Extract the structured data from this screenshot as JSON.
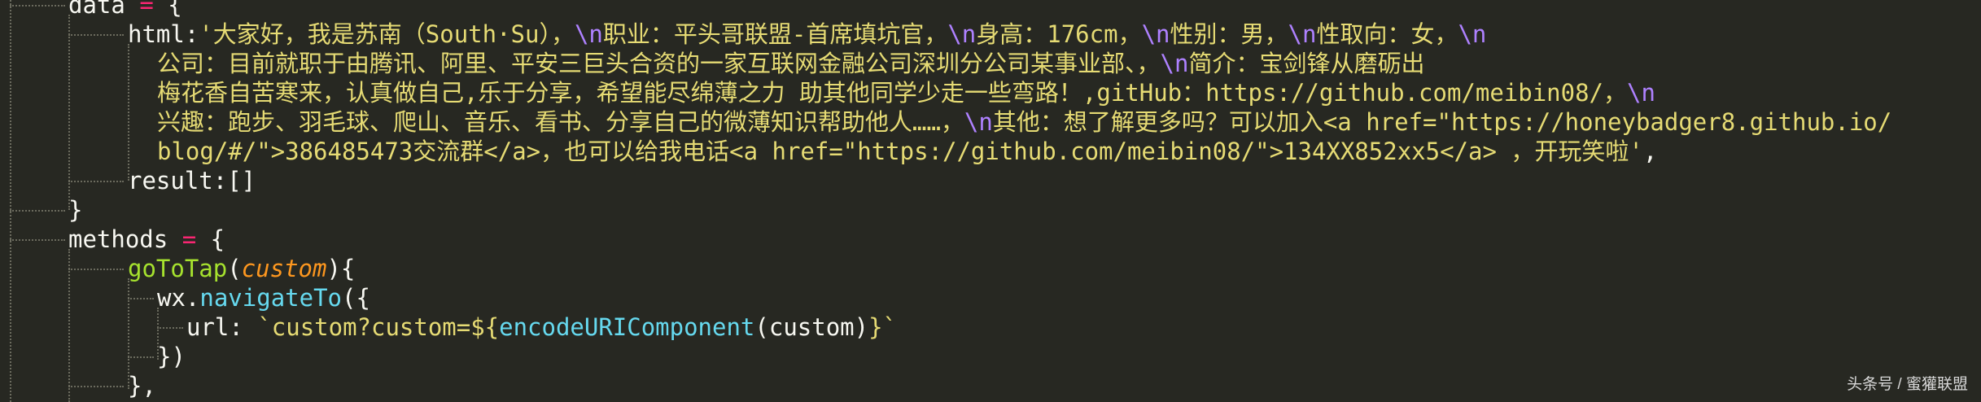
{
  "code": {
    "line1": {
      "ident": "data",
      "op": "=",
      "brace": "{"
    },
    "line2": {
      "key": "html:",
      "s1": "'大家好，我是苏南（South·Su），",
      "e1": "\\n",
      "s2": "职业：平头哥联盟-首席填坑官，",
      "e2": "\\n",
      "s3": "身高：176cm，",
      "e3": "\\n",
      "s4": "性别：男，",
      "e4": "\\n",
      "s5": "性取向：女，",
      "e5": "\\n"
    },
    "line3": {
      "s1": "公司：目前就职于由腾讯、阿里、平安三巨头合资的一家互联网金融公司深圳分公司某事业部、，",
      "e1": "\\n",
      "s2": "简介：宝剑锋从磨砺出"
    },
    "line4": {
      "s1": "梅花香自苦寒来，认真做自己,乐于分享，希望能尽绵薄之力 助其他同学少走一些弯路！,gitHub：https://github.com/meibin08/，",
      "e1": "\\n"
    },
    "line5": {
      "s1": "兴趣：跑步、羽毛球、爬山、音乐、看书、分享自己的微薄知识帮助他人……，",
      "e1": "\\n",
      "s2": "其他：想了解更多吗？可以加入<a href=\"https://honeybadger8.github.io/"
    },
    "line6": {
      "s1": "blog/#/\">386485473交流群</a>，也可以给我电话<a href=\"https://github.com/meibin08/\">134XX852xx5</a> ，开玩笑啦'",
      "tail": ","
    },
    "line7": {
      "text": "result:[]"
    },
    "line8": {
      "text": "}"
    },
    "line9": {
      "ident": "methods",
      "op": "=",
      "brace": "{"
    },
    "line10": {
      "fn": "goToTap",
      "open": "(",
      "param": "custom",
      "close": "){"
    },
    "line11": {
      "obj": "wx.",
      "method": "navigateTo",
      "open": "({"
    },
    "line12": {
      "key": "url: ",
      "t1": "`custom?custom=${",
      "fn": "encodeURIComponent",
      "t2": "(custom)",
      "t3": "}`"
    },
    "line13": {
      "text": "})"
    },
    "line14": {
      "text": "},"
    }
  },
  "watermark": "头条号 / 蜜獾联盟",
  "colors": {
    "background": "#272822",
    "keyword": "#f92672",
    "function": "#a6e22e",
    "property": "#66d9ef",
    "parameter": "#fd971f",
    "string": "#e6db74",
    "escape": "#ae81ff",
    "text": "#f8f8f2"
  }
}
